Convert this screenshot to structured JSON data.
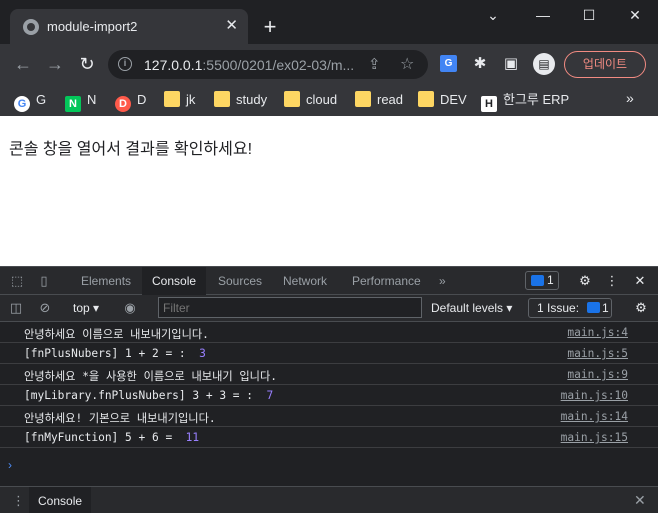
{
  "browser": {
    "tab_title": "module-import2",
    "url_host": "127.0.0.1",
    "url_rest": ":5500/0201/ex02-03/m...",
    "update_label": "업데이트"
  },
  "bookmarks": [
    {
      "label": "G",
      "icon": "google-icon"
    },
    {
      "label": "N",
      "icon": "naver-icon"
    },
    {
      "label": "D",
      "icon": "daum-icon"
    },
    {
      "label": "jk",
      "icon": "folder-icon"
    },
    {
      "label": "study",
      "icon": "folder-icon"
    },
    {
      "label": "cloud",
      "icon": "folder-icon"
    },
    {
      "label": "read",
      "icon": "folder-icon"
    },
    {
      "label": "DEV",
      "icon": "folder-icon"
    },
    {
      "label": "한그루 ERP",
      "icon": "erp-icon"
    }
  ],
  "page": {
    "message": "콘솔 창을 열어서 결과를 확인하세요!"
  },
  "devtools": {
    "tabs": [
      "Elements",
      "Console",
      "Sources",
      "Network",
      "Performance"
    ],
    "active_tab": "Console",
    "badge_count": "1",
    "context": "top",
    "filter_placeholder": "Filter",
    "levels": "Default levels",
    "issues_label": "1 Issue:",
    "issues_count": "1",
    "drawer_tab": "Console"
  },
  "console_rows": [
    {
      "text": "안녕하세요 이름으로 내보내기입니다.",
      "value": "",
      "source": "main.js:4"
    },
    {
      "text": "[fnPlusNubers] 1 + 2 = :  ",
      "value": "3",
      "source": "main.js:5"
    },
    {
      "text": "안녕하세요 *을 사용한 이름으로 내보내기 입니다.",
      "value": "",
      "source": "main.js:9"
    },
    {
      "text": "[myLibrary.fnPlusNubers] 3 + 3 = :  ",
      "value": "7",
      "source": "main.js:10"
    },
    {
      "text": "안녕하세요! 기본으로 내보내기입니다.",
      "value": "",
      "source": "main.js:14"
    },
    {
      "text": "[fnMyFunction] 5 + 6 =  ",
      "value": "11",
      "source": "main.js:15"
    }
  ],
  "colors": {
    "console_number": "#9980ff",
    "accent_blue": "#1a73e8",
    "update_red": "#f28b82"
  }
}
